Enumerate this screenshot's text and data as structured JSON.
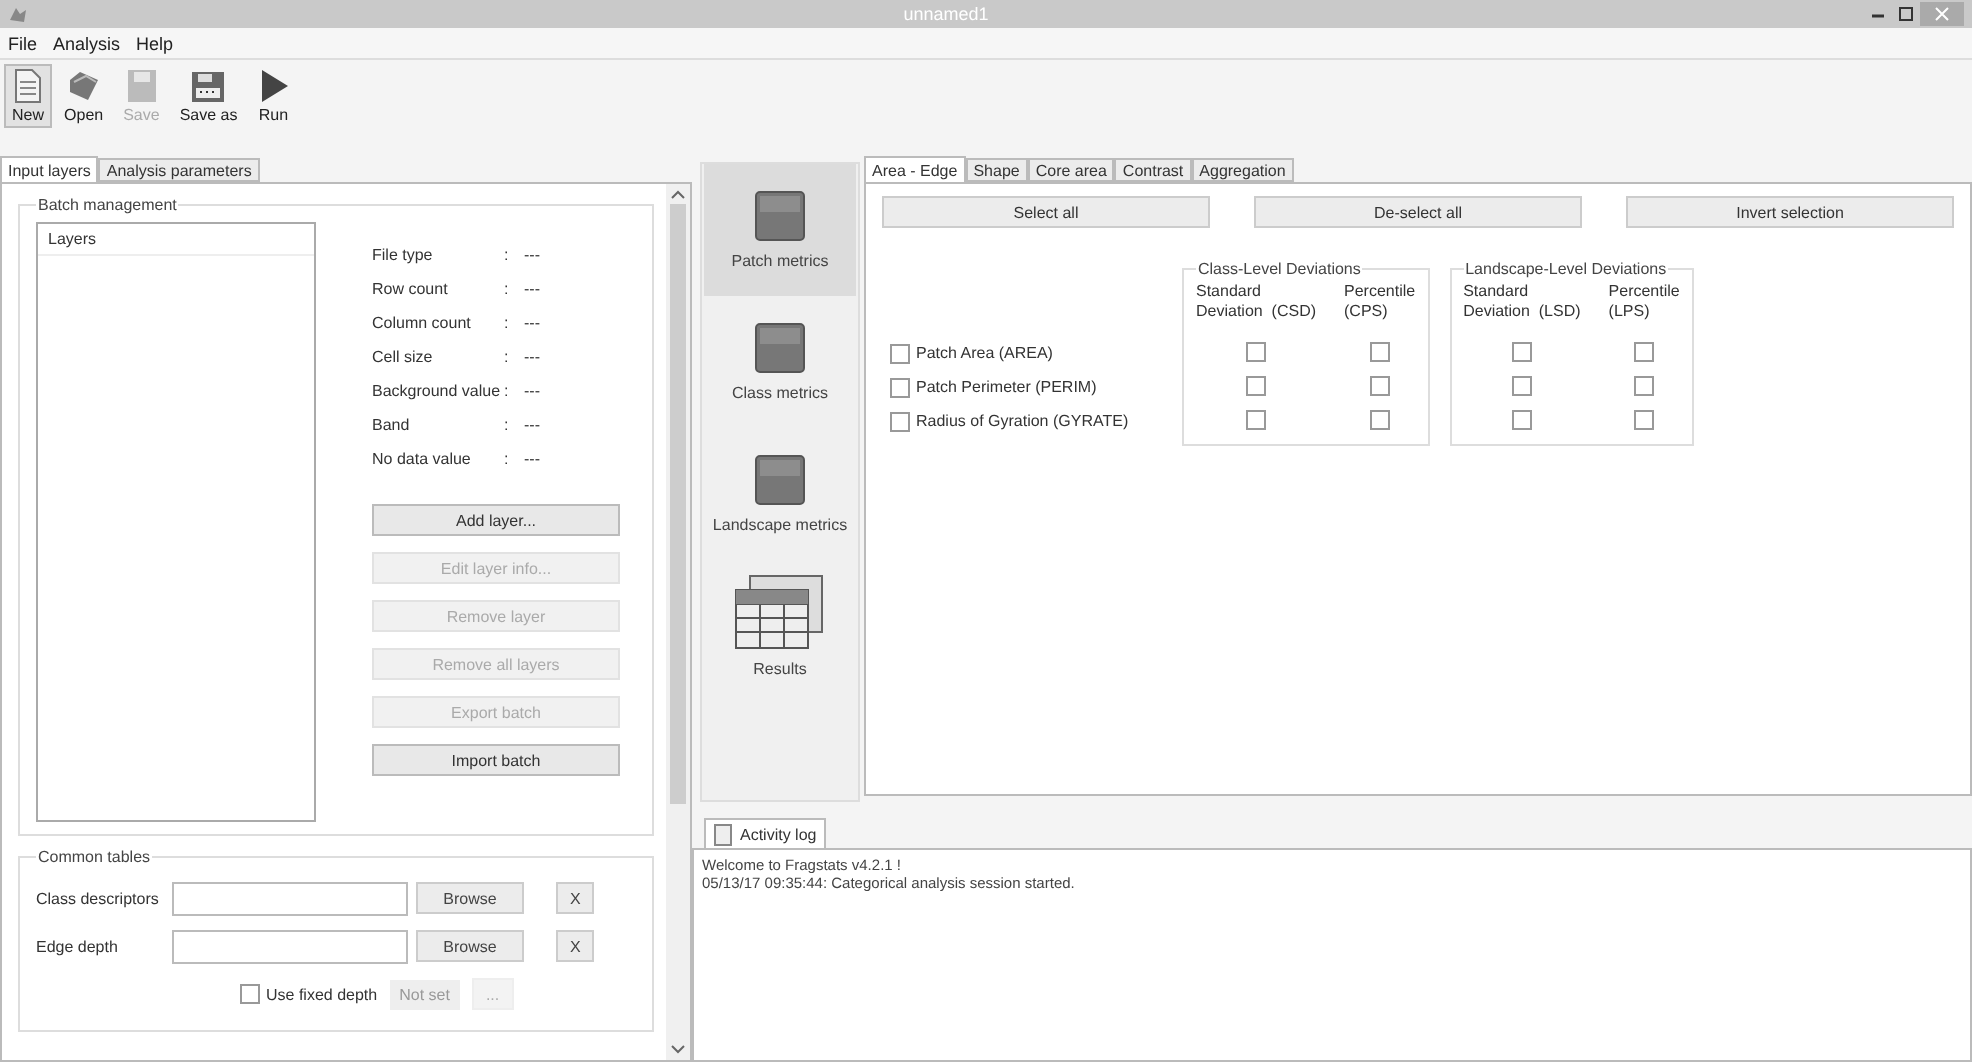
{
  "window": {
    "title": "unnamed1"
  },
  "menu": [
    "File",
    "Analysis",
    "Help"
  ],
  "toolbar": [
    {
      "label": "New",
      "kind": "new",
      "disabled": false,
      "highlighted": true
    },
    {
      "label": "Open",
      "kind": "open",
      "disabled": false,
      "highlighted": false
    },
    {
      "label": "Save",
      "kind": "save",
      "disabled": true,
      "highlighted": false
    },
    {
      "label": "Save as",
      "kind": "saveas",
      "disabled": false,
      "highlighted": false
    },
    {
      "label": "Run",
      "kind": "run",
      "disabled": false,
      "highlighted": false
    }
  ],
  "left_tabs": [
    {
      "label": "Input layers",
      "selected": true
    },
    {
      "label": "Analysis parameters",
      "selected": false
    }
  ],
  "batch": {
    "title": "Batch management",
    "list_header": "Layers",
    "properties": [
      {
        "label": "File type",
        "separator": ":",
        "value": "---"
      },
      {
        "label": "Row count",
        "separator": ":",
        "value": "---"
      },
      {
        "label": "Column count",
        "separator": ":",
        "value": "---"
      },
      {
        "label": "Cell size",
        "separator": ":",
        "value": "---"
      },
      {
        "label": "Background value",
        "separator": ":",
        "value": "---"
      },
      {
        "label": "Band",
        "separator": ":",
        "value": "---"
      },
      {
        "label": "No data value",
        "separator": ":",
        "value": "---"
      }
    ],
    "buttons": [
      {
        "label": "Add layer...",
        "disabled": false
      },
      {
        "label": "Edit layer info...",
        "disabled": true
      },
      {
        "label": "Remove layer",
        "disabled": true
      },
      {
        "label": "Remove all layers",
        "disabled": true
      },
      {
        "label": "Export batch",
        "disabled": true
      },
      {
        "label": "Import batch",
        "disabled": false
      }
    ]
  },
  "common_tables": {
    "title": "Common tables",
    "rows": [
      {
        "label": "Class descriptors",
        "browse": "Browse",
        "clear": "X"
      },
      {
        "label": "Edge depth",
        "browse": "Browse",
        "clear": "X"
      }
    ],
    "fixed_depth": {
      "label": "Use fixed depth",
      "checked": false,
      "value": "Not set",
      "button": "...",
      "button_disabled": true
    }
  },
  "metric_nav": [
    {
      "label": "Patch metrics",
      "kind": "square",
      "selected": true
    },
    {
      "label": "Class metrics",
      "kind": "square",
      "selected": false
    },
    {
      "label": "Landscape metrics",
      "kind": "square",
      "selected": false
    },
    {
      "label": "Results",
      "kind": "table",
      "selected": false
    }
  ],
  "metric_tabs": [
    {
      "label": "Area - Edge",
      "selected": true
    },
    {
      "label": "Shape",
      "selected": false
    },
    {
      "label": "Core area",
      "selected": false
    },
    {
      "label": "Contrast",
      "selected": false
    },
    {
      "label": "Aggregation",
      "selected": false
    }
  ],
  "select_buttons": [
    "Select all",
    "De-select all",
    "Invert selection"
  ],
  "deviation_groups": [
    {
      "title": "Class-Level Deviations",
      "columns": [
        [
          "Standard",
          "Deviation  (CSD)"
        ],
        [
          "Percentile",
          "(CPS)"
        ]
      ]
    },
    {
      "title": "Landscape-Level Deviations",
      "columns": [
        [
          "Standard",
          "Deviation  (LSD)"
        ],
        [
          "Percentile",
          "(LPS)"
        ]
      ]
    }
  ],
  "metrics": [
    {
      "label": "Patch Area  (AREA)",
      "checked": false,
      "deviation_checks": [
        false,
        false,
        false,
        false
      ]
    },
    {
      "label": "Patch Perimeter  (PERIM)",
      "checked": false,
      "deviation_checks": [
        false,
        false,
        false,
        false
      ]
    },
    {
      "label": "Radius of Gyration  (GYRATE)",
      "checked": false,
      "deviation_checks": [
        false,
        false,
        false,
        false
      ]
    }
  ],
  "activity_log": {
    "tab": "Activity log",
    "lines": [
      "Welcome to Fragstats v4.2.1 !",
      "05/13/17 09:35:44: Categorical analysis session started."
    ]
  }
}
